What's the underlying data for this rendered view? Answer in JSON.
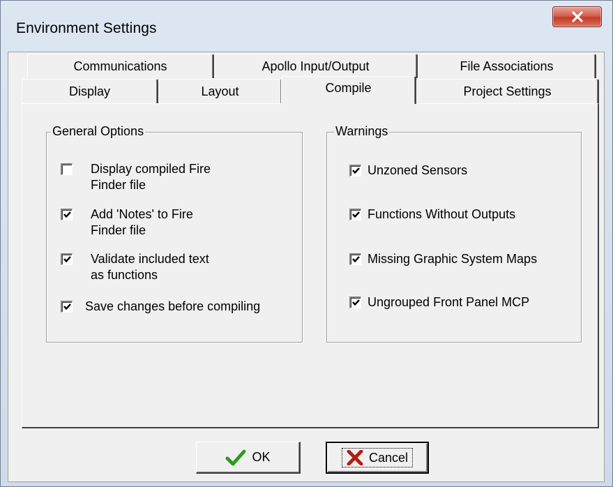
{
  "window": {
    "title": "Environment Settings",
    "close_icon": "close-icon"
  },
  "tabs": {
    "row1": [
      {
        "label": "Communications"
      },
      {
        "label": "Apollo Input/Output"
      },
      {
        "label": "File Associations"
      }
    ],
    "row2": [
      {
        "label": "Display"
      },
      {
        "label": "Layout"
      },
      {
        "label": "Compile",
        "active": true
      },
      {
        "label": "Project Settings"
      }
    ]
  },
  "general_options": {
    "title": "General Options",
    "items": [
      {
        "line1": "Display compiled Fire",
        "line2": "Finder file",
        "checked": false
      },
      {
        "line1": "Add 'Notes' to Fire",
        "line2": "Finder file",
        "checked": true
      },
      {
        "line1": "Validate included text",
        "line2": "as functions",
        "checked": true
      },
      {
        "line1": "Save changes before compiling",
        "line2": "",
        "checked": true
      }
    ]
  },
  "warnings": {
    "title": "Warnings",
    "items": [
      {
        "label": "Unzoned Sensors",
        "checked": true
      },
      {
        "label": "Functions Without Outputs",
        "checked": true
      },
      {
        "label": "Missing Graphic System Maps",
        "checked": true
      },
      {
        "label": "Ungrouped Front Panel MCP",
        "checked": true
      }
    ]
  },
  "buttons": {
    "ok_label": "OK",
    "ok_icon": "checkmark-icon",
    "cancel_label": "Cancel",
    "cancel_icon": "x-icon"
  },
  "colors": {
    "ok_check": "#2e9b1e",
    "cancel_x": "#b01e14",
    "close_button": "#c43b28"
  }
}
